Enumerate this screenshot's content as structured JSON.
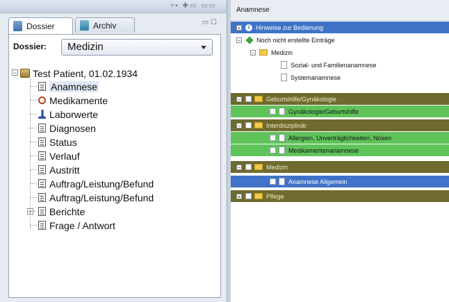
{
  "left_panel": {
    "tabs": [
      {
        "label": "Dossier",
        "active": true
      },
      {
        "label": "Archiv",
        "active": false
      }
    ],
    "dossier_label": "Dossier:",
    "dossier_value": "Medizin",
    "patient": "Test Patient, 01.02.1934",
    "items": [
      {
        "label": "Anamnese",
        "icon": "document-icon"
      },
      {
        "label": "Medikamente",
        "icon": "pills-icon"
      },
      {
        "label": "Laborwerte",
        "icon": "microscope-icon"
      },
      {
        "label": "Diagnosen",
        "icon": "document-icon"
      },
      {
        "label": "Status",
        "icon": "document-icon"
      },
      {
        "label": "Verlauf",
        "icon": "document-icon"
      },
      {
        "label": "Austritt",
        "icon": "document-icon"
      },
      {
        "label": "Auftrag/Leistung/Befund",
        "icon": "document-icon"
      },
      {
        "label": "Auftrag/Leistung/Befund",
        "icon": "document-icon"
      },
      {
        "label": "Berichte",
        "icon": "document-icon"
      },
      {
        "label": "Frage / Antwort",
        "icon": "document-icon"
      }
    ]
  },
  "right_panel": {
    "title": "Anamnese",
    "rows": [
      {
        "label": "Hinweise zur Bedienung",
        "style": "blue"
      },
      {
        "label": "Noch nicht erstellte Einträge",
        "style": "white"
      },
      {
        "label": "Medizin",
        "style": "white"
      },
      {
        "label": "Sozial- und Familienanamnese",
        "style": "white"
      },
      {
        "label": "Systemanamnese",
        "style": "white"
      },
      {
        "label": "Geburtshilfe/Gynäkologie",
        "style": "olive"
      },
      {
        "label": "Gynäkologie/Geburtshilfe",
        "style": "green"
      },
      {
        "label": "Interdisziplinär",
        "style": "olive"
      },
      {
        "label": "Allergien, Unverträglichkeiten, Noxen",
        "style": "green"
      },
      {
        "label": "Medikamentenanamnese",
        "style": "green"
      },
      {
        "label": "Medizin",
        "style": "olive"
      },
      {
        "label": "Anamnese Allgemein",
        "style": "blue"
      },
      {
        "label": "Pflege",
        "style": "olive"
      }
    ]
  },
  "colors": {
    "blue_row": "#3f73c8",
    "olive_row": "#6f6a2e",
    "green_row": "#5fc35a"
  }
}
